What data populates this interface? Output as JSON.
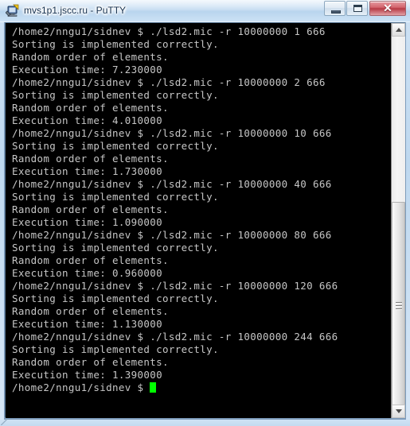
{
  "window": {
    "title": "mvs1p1.jscc.ru - PuTTY",
    "app_icon": "putty-icon",
    "caption": {
      "minimize_label": "",
      "maximize_label": "",
      "close_label": "✕"
    },
    "frame_color": "#c2daf0",
    "close_button_color": "#b63a45"
  },
  "terminal": {
    "background": "#000000",
    "foreground": "#c6c6c6",
    "cursor_color": "#00ff00",
    "prompt": "/home2/nngu1/sidnev $",
    "command": "./lsd2.mic -r 10000000",
    "lines": [
      "/home2/nngu1/sidnev $ ./lsd2.mic -r 10000000 1 666",
      "Sorting is implemented correctly.",
      "Random order of elements.",
      "Execution time: 7.230000",
      "/home2/nngu1/sidnev $ ./lsd2.mic -r 10000000 2 666",
      "Sorting is implemented correctly.",
      "Random order of elements.",
      "Execution time: 4.010000",
      "/home2/nngu1/sidnev $ ./lsd2.mic -r 10000000 10 666",
      "Sorting is implemented correctly.",
      "Random order of elements.",
      "Execution time: 1.730000",
      "/home2/nngu1/sidnev $ ./lsd2.mic -r 10000000 40 666",
      "Sorting is implemented correctly.",
      "Random order of elements.",
      "Execution time: 1.090000",
      "/home2/nngu1/sidnev $ ./lsd2.mic -r 10000000 80 666",
      "Sorting is implemented correctly.",
      "Random order of elements.",
      "Execution time: 0.960000",
      "/home2/nngu1/sidnev $ ./lsd2.mic -r 10000000 120 666",
      "Sorting is implemented correctly.",
      "Random order of elements.",
      "Execution time: 1.130000",
      "/home2/nngu1/sidnev $ ./lsd2.mic -r 10000000 244 666",
      "Sorting is implemented correctly.",
      "Random order of elements.",
      "Execution time: 1.390000"
    ],
    "last_prompt": "/home2/nngu1/sidnev $ ",
    "runs": [
      {
        "threads": "1",
        "seed": "666",
        "elements": "10000000",
        "execution_time": "7.230000",
        "status": "Sorting is implemented correctly.",
        "order": "Random order of elements."
      },
      {
        "threads": "2",
        "seed": "666",
        "elements": "10000000",
        "execution_time": "4.010000",
        "status": "Sorting is implemented correctly.",
        "order": "Random order of elements."
      },
      {
        "threads": "10",
        "seed": "666",
        "elements": "10000000",
        "execution_time": "1.730000",
        "status": "Sorting is implemented correctly.",
        "order": "Random order of elements."
      },
      {
        "threads": "40",
        "seed": "666",
        "elements": "10000000",
        "execution_time": "1.090000",
        "status": "Sorting is implemented correctly.",
        "order": "Random order of elements."
      },
      {
        "threads": "80",
        "seed": "666",
        "elements": "10000000",
        "execution_time": "0.960000",
        "status": "Sorting is implemented correctly.",
        "order": "Random order of elements."
      },
      {
        "threads": "120",
        "seed": "666",
        "elements": "10000000",
        "execution_time": "1.130000",
        "status": "Sorting is implemented correctly.",
        "order": "Random order of elements."
      },
      {
        "threads": "244",
        "seed": "666",
        "elements": "10000000",
        "execution_time": "1.390000",
        "status": "Sorting is implemented correctly.",
        "order": "Random order of elements."
      }
    ]
  },
  "scrollbar": {
    "up_arrow": "scroll-up-arrow",
    "down_arrow": "scroll-down-arrow",
    "thumb": "scroll-thumb"
  }
}
